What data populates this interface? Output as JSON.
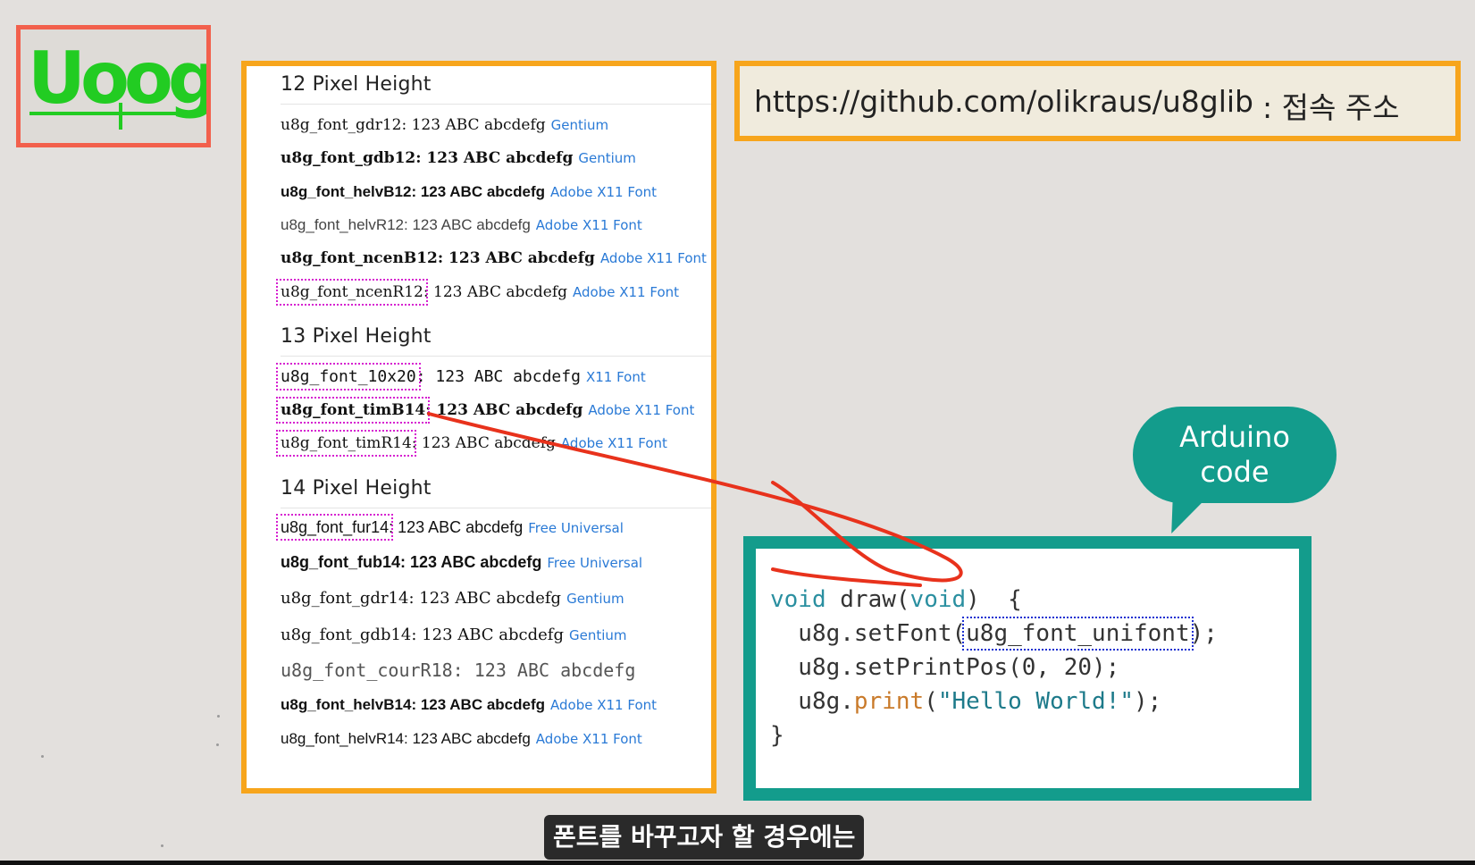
{
  "logo": {
    "text": "Uoog"
  },
  "font_panel": {
    "sections": [
      {
        "title": "12 Pixel Height",
        "rows": [
          {
            "name": "u8g_font_gdr12",
            "sample": ": 123 ABC abcdefg",
            "source": "Gentium"
          },
          {
            "name": "u8g_font_gdb12",
            "sample": ": 123 ABC abcdefg",
            "source": "Gentium"
          },
          {
            "name": "u8g_font_helvB12",
            "sample": ": 123 ABC abcdefg",
            "source": "Adobe X11 Font"
          },
          {
            "name": "u8g_font_helvR12",
            "sample": ": 123 ABC abcdefg",
            "source": "Adobe X11 Font"
          },
          {
            "name": "u8g_font_ncenB12",
            "sample": ": 123 ABC abcdefg",
            "source": "Adobe X11 Font"
          },
          {
            "name": "u8g_font_ncenR12",
            "sample": ": 123 ABC abcdefg",
            "source": "Adobe X11 Font"
          }
        ]
      },
      {
        "title": "13 Pixel Height",
        "rows": [
          {
            "name": "u8g_font_10x20",
            "sample": ":  123 ABC abcdefg",
            "source": "X11 Font"
          },
          {
            "name": "u8g_font_timB14",
            "sample": ": 123 ABC abcdefg",
            "source": "Adobe X11 Font"
          },
          {
            "name": "u8g_font_timR14",
            "sample": ": 123 ABC abcdefg",
            "source": "Adobe X11 Font"
          }
        ]
      },
      {
        "title": "14 Pixel Height",
        "rows": [
          {
            "name": "u8g_font_fur14",
            "sample": ": 123 ABC abcdefg",
            "source": "Free Universal"
          },
          {
            "name": "u8g_font_fub14",
            "sample": ": 123 ABC abcdefg",
            "source": "Free Universal"
          },
          {
            "name": "u8g_font_gdr14",
            "sample": ": 123 ABC abcdefg",
            "source": "Gentium"
          },
          {
            "name": "u8g_font_gdb14",
            "sample": ": 123 ABC abcdefg",
            "source": "Gentium"
          },
          {
            "name": "u8g_font_courR18",
            "sample": ": 123 ABC abcdefg",
            "source": ""
          },
          {
            "name": "u8g_font_helvB14",
            "sample": ": 123 ABC abcdefg",
            "source": "Adobe X11 Font"
          },
          {
            "name": "u8g_font_helvR14",
            "sample": ": 123 ABC abcdefg",
            "source": "Adobe X11 Font"
          }
        ]
      }
    ]
  },
  "url_box": {
    "url": "https://github.com/olikraus/u8glib",
    "label": ": 접속 주소"
  },
  "bubble": {
    "line1": "Arduino",
    "line2": "code"
  },
  "code": {
    "l1_kw1": "void",
    "l1_mid": " draw(",
    "l1_kw2": "void",
    "l1_end": ")  {",
    "l2_pre": "  u8g.setFont(",
    "l2_hl": "u8g_font_unifont",
    "l2_end": ");",
    "l3": "  u8g.setPrintPos(0, 20);",
    "l4_pre": "  u8g.",
    "l4_fn": "print",
    "l4_open": "(",
    "l4_str": "\"Hello World!\"",
    "l4_end": ");",
    "l5": "}"
  },
  "subtitle": "폰트를 바꾸고자 할 경우에는",
  "colors": {
    "panel_border": "#f7a51c",
    "logo_border": "#f2604c",
    "logo_green": "#22cc22",
    "teal": "#139c8c",
    "source_link": "#2a7ad6",
    "highlight_magenta": "#d61fd0",
    "arrow_red": "#e8321c"
  }
}
